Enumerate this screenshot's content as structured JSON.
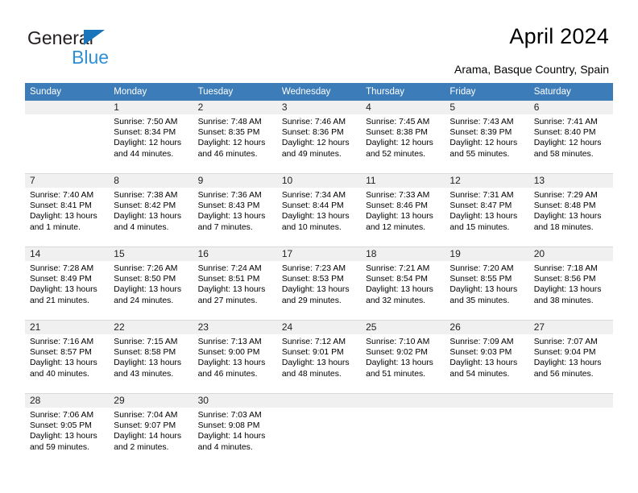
{
  "brand": {
    "name_part1": "General",
    "name_part2": "Blue",
    "accent_color": "#2f8fd6",
    "triangle_color": "#1b75bb"
  },
  "header": {
    "title": "April 2024",
    "subtitle": "Arama, Basque Country, Spain",
    "header_bg": "#3c7cb8"
  },
  "weekdays": [
    "Sunday",
    "Monday",
    "Tuesday",
    "Wednesday",
    "Thursday",
    "Friday",
    "Saturday"
  ],
  "weeks": [
    [
      {
        "day": "",
        "sunrise": "",
        "sunset": "",
        "daylight1": "",
        "daylight2": "",
        "blank": true
      },
      {
        "day": "1",
        "sunrise": "Sunrise: 7:50 AM",
        "sunset": "Sunset: 8:34 PM",
        "daylight1": "Daylight: 12 hours",
        "daylight2": "and 44 minutes."
      },
      {
        "day": "2",
        "sunrise": "Sunrise: 7:48 AM",
        "sunset": "Sunset: 8:35 PM",
        "daylight1": "Daylight: 12 hours",
        "daylight2": "and 46 minutes."
      },
      {
        "day": "3",
        "sunrise": "Sunrise: 7:46 AM",
        "sunset": "Sunset: 8:36 PM",
        "daylight1": "Daylight: 12 hours",
        "daylight2": "and 49 minutes."
      },
      {
        "day": "4",
        "sunrise": "Sunrise: 7:45 AM",
        "sunset": "Sunset: 8:38 PM",
        "daylight1": "Daylight: 12 hours",
        "daylight2": "and 52 minutes."
      },
      {
        "day": "5",
        "sunrise": "Sunrise: 7:43 AM",
        "sunset": "Sunset: 8:39 PM",
        "daylight1": "Daylight: 12 hours",
        "daylight2": "and 55 minutes."
      },
      {
        "day": "6",
        "sunrise": "Sunrise: 7:41 AM",
        "sunset": "Sunset: 8:40 PM",
        "daylight1": "Daylight: 12 hours",
        "daylight2": "and 58 minutes."
      }
    ],
    [
      {
        "day": "7",
        "sunrise": "Sunrise: 7:40 AM",
        "sunset": "Sunset: 8:41 PM",
        "daylight1": "Daylight: 13 hours",
        "daylight2": "and 1 minute."
      },
      {
        "day": "8",
        "sunrise": "Sunrise: 7:38 AM",
        "sunset": "Sunset: 8:42 PM",
        "daylight1": "Daylight: 13 hours",
        "daylight2": "and 4 minutes."
      },
      {
        "day": "9",
        "sunrise": "Sunrise: 7:36 AM",
        "sunset": "Sunset: 8:43 PM",
        "daylight1": "Daylight: 13 hours",
        "daylight2": "and 7 minutes."
      },
      {
        "day": "10",
        "sunrise": "Sunrise: 7:34 AM",
        "sunset": "Sunset: 8:44 PM",
        "daylight1": "Daylight: 13 hours",
        "daylight2": "and 10 minutes."
      },
      {
        "day": "11",
        "sunrise": "Sunrise: 7:33 AM",
        "sunset": "Sunset: 8:46 PM",
        "daylight1": "Daylight: 13 hours",
        "daylight2": "and 12 minutes."
      },
      {
        "day": "12",
        "sunrise": "Sunrise: 7:31 AM",
        "sunset": "Sunset: 8:47 PM",
        "daylight1": "Daylight: 13 hours",
        "daylight2": "and 15 minutes."
      },
      {
        "day": "13",
        "sunrise": "Sunrise: 7:29 AM",
        "sunset": "Sunset: 8:48 PM",
        "daylight1": "Daylight: 13 hours",
        "daylight2": "and 18 minutes."
      }
    ],
    [
      {
        "day": "14",
        "sunrise": "Sunrise: 7:28 AM",
        "sunset": "Sunset: 8:49 PM",
        "daylight1": "Daylight: 13 hours",
        "daylight2": "and 21 minutes."
      },
      {
        "day": "15",
        "sunrise": "Sunrise: 7:26 AM",
        "sunset": "Sunset: 8:50 PM",
        "daylight1": "Daylight: 13 hours",
        "daylight2": "and 24 minutes."
      },
      {
        "day": "16",
        "sunrise": "Sunrise: 7:24 AM",
        "sunset": "Sunset: 8:51 PM",
        "daylight1": "Daylight: 13 hours",
        "daylight2": "and 27 minutes."
      },
      {
        "day": "17",
        "sunrise": "Sunrise: 7:23 AM",
        "sunset": "Sunset: 8:53 PM",
        "daylight1": "Daylight: 13 hours",
        "daylight2": "and 29 minutes."
      },
      {
        "day": "18",
        "sunrise": "Sunrise: 7:21 AM",
        "sunset": "Sunset: 8:54 PM",
        "daylight1": "Daylight: 13 hours",
        "daylight2": "and 32 minutes."
      },
      {
        "day": "19",
        "sunrise": "Sunrise: 7:20 AM",
        "sunset": "Sunset: 8:55 PM",
        "daylight1": "Daylight: 13 hours",
        "daylight2": "and 35 minutes."
      },
      {
        "day": "20",
        "sunrise": "Sunrise: 7:18 AM",
        "sunset": "Sunset: 8:56 PM",
        "daylight1": "Daylight: 13 hours",
        "daylight2": "and 38 minutes."
      }
    ],
    [
      {
        "day": "21",
        "sunrise": "Sunrise: 7:16 AM",
        "sunset": "Sunset: 8:57 PM",
        "daylight1": "Daylight: 13 hours",
        "daylight2": "and 40 minutes."
      },
      {
        "day": "22",
        "sunrise": "Sunrise: 7:15 AM",
        "sunset": "Sunset: 8:58 PM",
        "daylight1": "Daylight: 13 hours",
        "daylight2": "and 43 minutes."
      },
      {
        "day": "23",
        "sunrise": "Sunrise: 7:13 AM",
        "sunset": "Sunset: 9:00 PM",
        "daylight1": "Daylight: 13 hours",
        "daylight2": "and 46 minutes."
      },
      {
        "day": "24",
        "sunrise": "Sunrise: 7:12 AM",
        "sunset": "Sunset: 9:01 PM",
        "daylight1": "Daylight: 13 hours",
        "daylight2": "and 48 minutes."
      },
      {
        "day": "25",
        "sunrise": "Sunrise: 7:10 AM",
        "sunset": "Sunset: 9:02 PM",
        "daylight1": "Daylight: 13 hours",
        "daylight2": "and 51 minutes."
      },
      {
        "day": "26",
        "sunrise": "Sunrise: 7:09 AM",
        "sunset": "Sunset: 9:03 PM",
        "daylight1": "Daylight: 13 hours",
        "daylight2": "and 54 minutes."
      },
      {
        "day": "27",
        "sunrise": "Sunrise: 7:07 AM",
        "sunset": "Sunset: 9:04 PM",
        "daylight1": "Daylight: 13 hours",
        "daylight2": "and 56 minutes."
      }
    ],
    [
      {
        "day": "28",
        "sunrise": "Sunrise: 7:06 AM",
        "sunset": "Sunset: 9:05 PM",
        "daylight1": "Daylight: 13 hours",
        "daylight2": "and 59 minutes."
      },
      {
        "day": "29",
        "sunrise": "Sunrise: 7:04 AM",
        "sunset": "Sunset: 9:07 PM",
        "daylight1": "Daylight: 14 hours",
        "daylight2": "and 2 minutes."
      },
      {
        "day": "30",
        "sunrise": "Sunrise: 7:03 AM",
        "sunset": "Sunset: 9:08 PM",
        "daylight1": "Daylight: 14 hours",
        "daylight2": "and 4 minutes."
      },
      {
        "day": "",
        "sunrise": "",
        "sunset": "",
        "daylight1": "",
        "daylight2": "",
        "blank": true
      },
      {
        "day": "",
        "sunrise": "",
        "sunset": "",
        "daylight1": "",
        "daylight2": "",
        "blank": true
      },
      {
        "day": "",
        "sunrise": "",
        "sunset": "",
        "daylight1": "",
        "daylight2": "",
        "blank": true
      },
      {
        "day": "",
        "sunrise": "",
        "sunset": "",
        "daylight1": "",
        "daylight2": "",
        "blank": true
      }
    ]
  ]
}
